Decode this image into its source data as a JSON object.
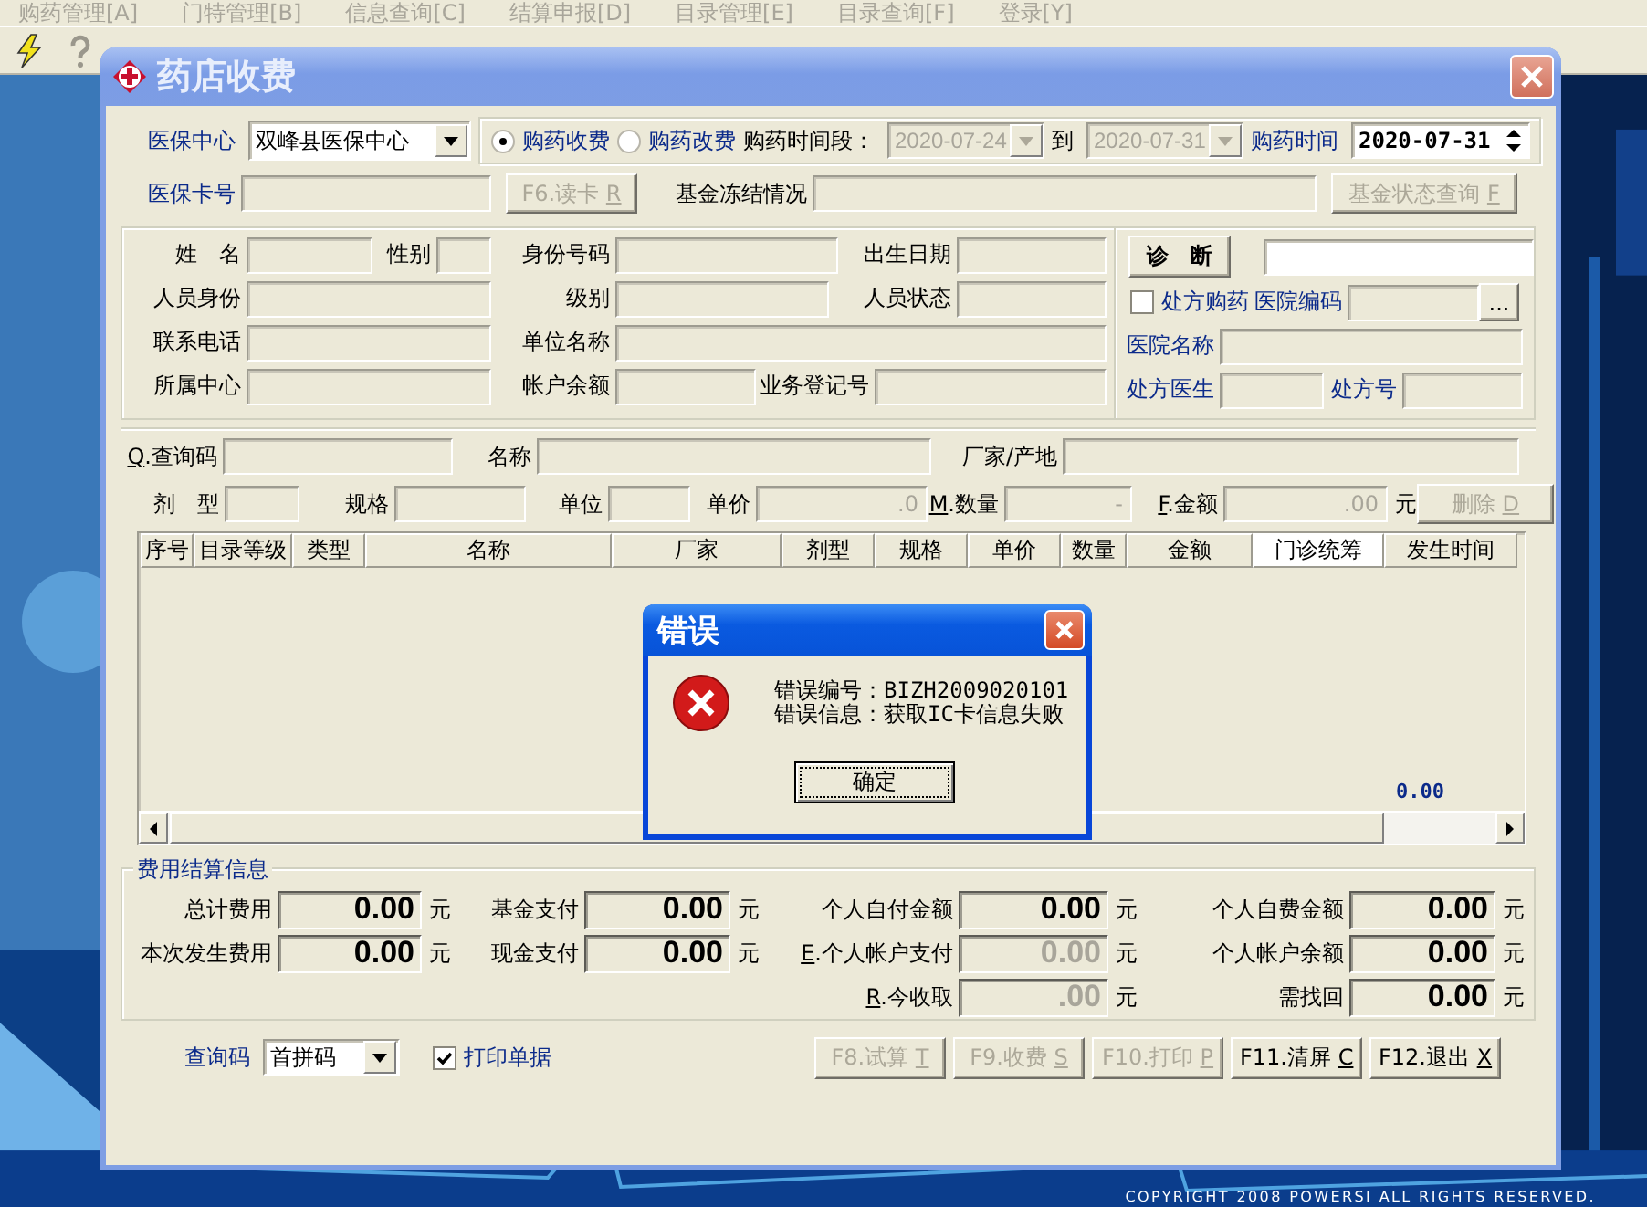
{
  "menu_bar": [
    {
      "label": "购药管理[A]",
      "disabled": true
    },
    {
      "label": "门特管理[B]",
      "disabled": true
    },
    {
      "label": "信息查询[C]",
      "disabled": true
    },
    {
      "label": "结算申报[D]",
      "disabled": true
    },
    {
      "label": "目录管理[E]",
      "disabled": true
    },
    {
      "label": "目录查询[F]",
      "disabled": true
    },
    {
      "label": "登录[Y]",
      "disabled": true
    }
  ],
  "window": {
    "title": "药店收费"
  },
  "header": {
    "center": {
      "label": "医保中心",
      "value": "双峰县医保中心"
    },
    "modes": [
      {
        "label": "购药收费",
        "selected": true
      },
      {
        "label": "购药改费",
        "selected": false
      }
    ],
    "period": {
      "label": "购药时间段：",
      "from": "2020-07-24",
      "to_label": "到",
      "to": "2020-07-31",
      "disabled": true
    },
    "date": {
      "label": "购药时间",
      "value": "2020-07-31"
    },
    "card": {
      "label": "医保卡号"
    },
    "read_card_button": {
      "label": "F6.读卡",
      "hotkey": "R",
      "disabled": true
    },
    "freeze": {
      "label": "基金冻结情况"
    },
    "fund_status_button": {
      "label": "基金状态查询",
      "hotkey": "F",
      "disabled": true
    }
  },
  "person": {
    "fields": [
      {
        "label": "姓　名"
      },
      {
        "label": "性别"
      },
      {
        "label": "身份号码"
      },
      {
        "label": "出生日期"
      },
      {
        "label": "人员身份"
      },
      {
        "label": "级别"
      },
      {
        "label": "人员状态"
      },
      {
        "label": "联系电话"
      },
      {
        "label": "单位名称"
      },
      {
        "label": "所属中心"
      },
      {
        "label": "帐户余额"
      },
      {
        "label": "业务登记号"
      }
    ]
  },
  "prescription": {
    "diagnosis_button": {
      "label": "诊　断"
    },
    "prescription_checkbox": {
      "label": "处方购药",
      "checked": false
    },
    "hospital_code": {
      "label": "医院编码"
    },
    "browse_button": {
      "label": "..."
    },
    "hospital_name": {
      "label": "医院名称"
    },
    "doctor": {
      "label": "处方医生"
    },
    "prescription_no": {
      "label": "处方号"
    }
  },
  "drug_entry": {
    "row_1": [
      {
        "label": "Q.查询码",
        "hotkey_prefix": true
      },
      {
        "label": "名称",
        "hotkey_prefix": false
      },
      {
        "label": "厂家/产地",
        "hotkey_prefix": false
      }
    ],
    "row_2": [
      {
        "label": "剂　型",
        "hotkey_prefix": false
      },
      {
        "label": "规格",
        "hotkey_prefix": false
      },
      {
        "label": "单位",
        "hotkey_prefix": false
      },
      {
        "label": "单价",
        "hotkey_prefix": false,
        "value": ".0"
      },
      {
        "label": "M.数量",
        "hotkey_prefix": true,
        "value": "-"
      },
      {
        "label": "F.金额",
        "hotkey_prefix": true,
        "value": ".00",
        "unit": "元"
      }
    ],
    "delete_button": {
      "label": "删除",
      "hotkey": "D",
      "disabled": true
    }
  },
  "table": {
    "columns": [
      {
        "label": "序号",
        "selected": false
      },
      {
        "label": "目录等级",
        "selected": false
      },
      {
        "label": "类型",
        "selected": false
      },
      {
        "label": "名称",
        "selected": false
      },
      {
        "label": "厂家",
        "selected": false
      },
      {
        "label": "剂型",
        "selected": false
      },
      {
        "label": "规格",
        "selected": false
      },
      {
        "label": "单价",
        "selected": false
      },
      {
        "label": "数量",
        "selected": false
      },
      {
        "label": "金额",
        "selected": false
      },
      {
        "label": "门诊统筹",
        "selected": true
      },
      {
        "label": "发生时间",
        "selected": false
      }
    ],
    "total": "0.00"
  },
  "settlement": {
    "title": "费用结算信息",
    "columns": [
      [
        {
          "label": "总计费用",
          "value": "0.00",
          "unit": "元",
          "disabled": false,
          "hotkey_prefix": false
        },
        {
          "label": "本次发生费用",
          "value": "0.00",
          "unit": "元",
          "disabled": false,
          "hotkey_prefix": false
        }
      ],
      [
        {
          "label": "基金支付",
          "value": "0.00",
          "unit": "元",
          "disabled": false,
          "hotkey_prefix": false
        },
        {
          "label": "现金支付",
          "value": "0.00",
          "unit": "元",
          "disabled": false,
          "hotkey_prefix": false
        }
      ],
      [
        {
          "label": "个人自付金额",
          "value": "0.00",
          "unit": "元",
          "disabled": false,
          "hotkey_prefix": false
        },
        {
          "label": "E.个人帐户支付",
          "value": "0.00",
          "unit": "元",
          "disabled": true,
          "hotkey_prefix": true
        },
        {
          "label": "R.今收取",
          "value": ".00",
          "unit": "元",
          "disabled": true,
          "hotkey_prefix": true
        }
      ],
      [
        {
          "label": "个人自费金额",
          "value": "0.00",
          "unit": "元",
          "disabled": false,
          "hotkey_prefix": false
        },
        {
          "label": "个人帐户余额",
          "value": "0.00",
          "unit": "元",
          "disabled": false,
          "hotkey_prefix": false
        },
        {
          "label": "需找回",
          "value": "0.00",
          "unit": "元",
          "disabled": false,
          "hotkey_prefix": false
        }
      ]
    ]
  },
  "footer": {
    "query": {
      "label": "查询码",
      "value": "首拼码"
    },
    "print_checkbox": {
      "label": "打印单据",
      "checked": true
    },
    "buttons": [
      {
        "label": "F8.试算",
        "hotkey": "T",
        "disabled": true
      },
      {
        "label": "F9.收费",
        "hotkey": "S",
        "disabled": true
      },
      {
        "label": "F10.打印",
        "hotkey": "P",
        "disabled": true
      },
      {
        "label": "F11.清屏",
        "hotkey": "C",
        "disabled": false
      },
      {
        "label": "F12.退出",
        "hotkey": "X",
        "disabled": false
      }
    ]
  },
  "error_dialog": {
    "title": "错误",
    "lines": [
      "错误编号：BIZH2009020101",
      "错误信息：获取IC卡信息失败"
    ],
    "ok_button": "确定"
  },
  "copyright": "COPYRIGHT 2008 POWERSI ALL RIGHTS RESERVED."
}
